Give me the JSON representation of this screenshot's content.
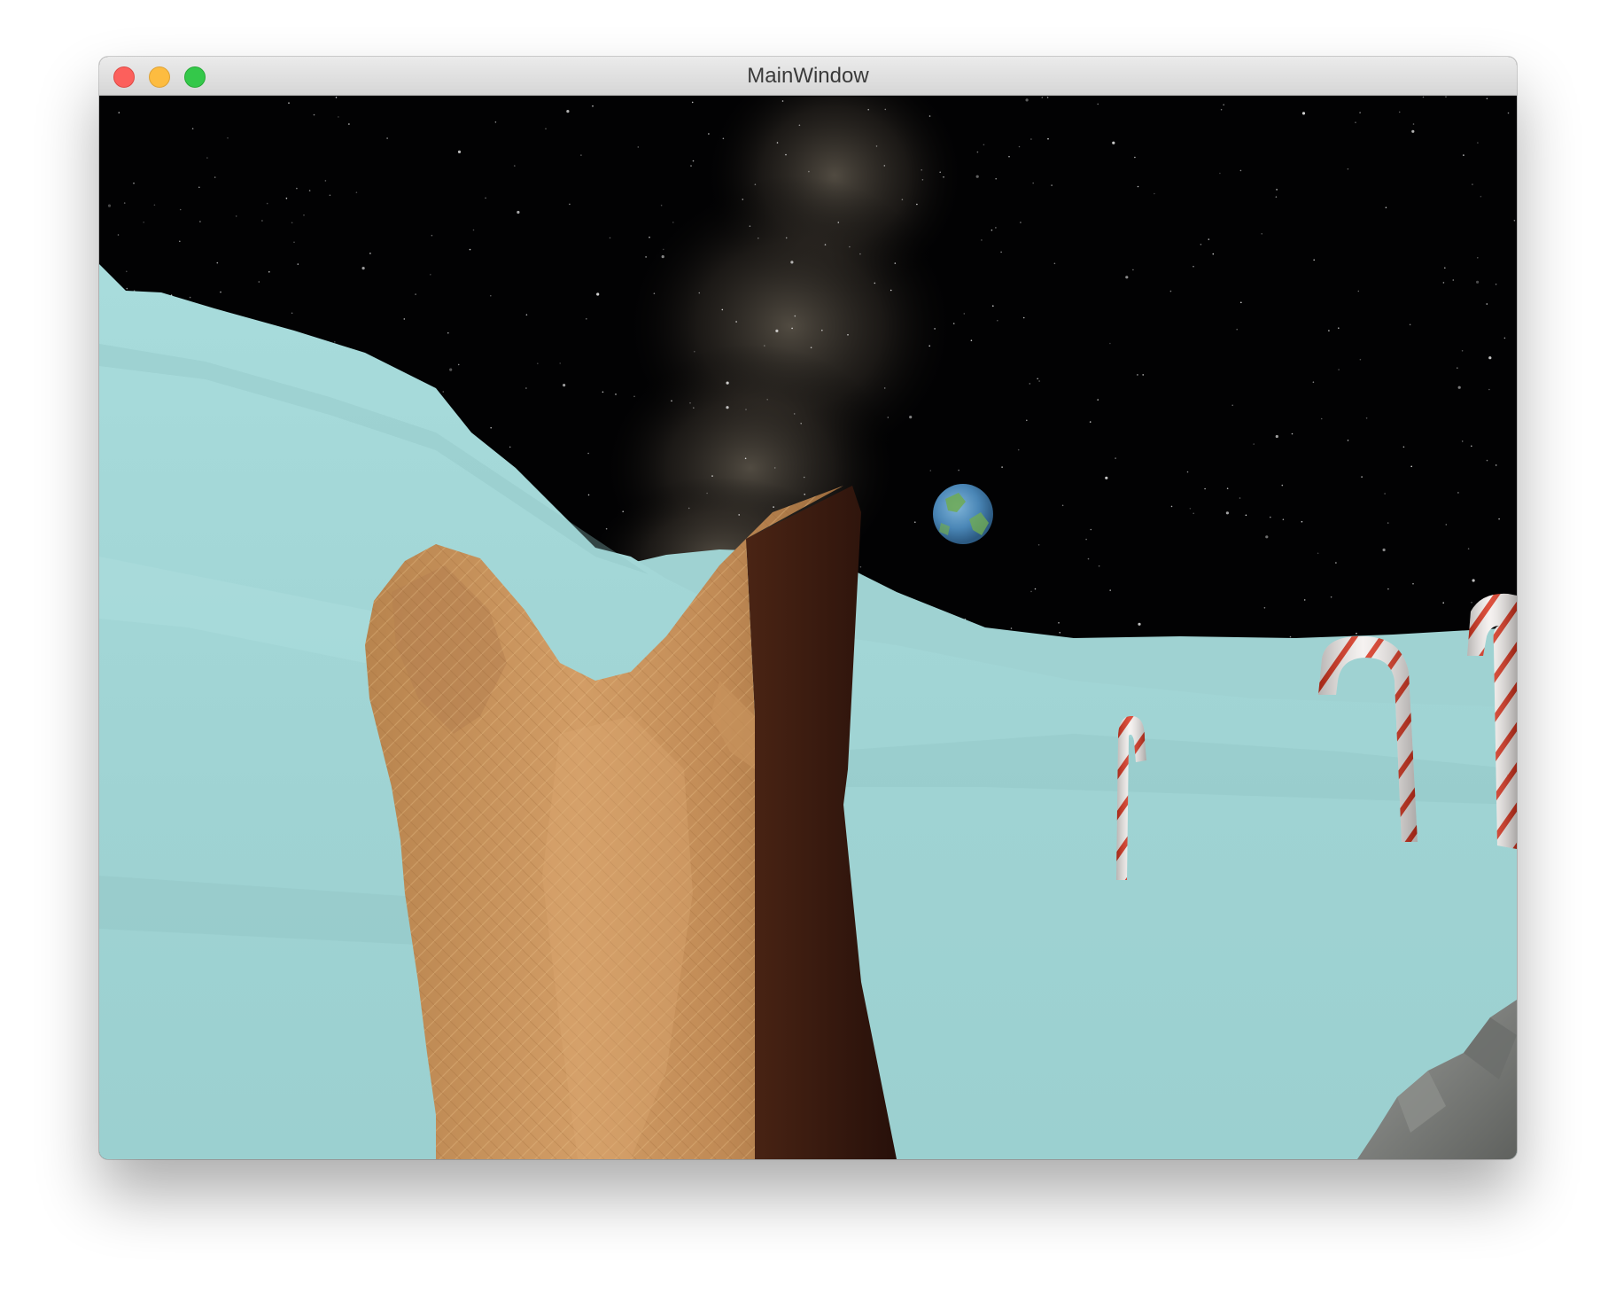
{
  "window": {
    "title": "MainWindow"
  },
  "scene": {
    "sky_color": "#020203",
    "milky_way_color": "#6b6356",
    "terrain_color": "#a3d8d8",
    "terrain_shade_color": "#8fc4c4",
    "fox_fur_color": "#c8935c",
    "fox_shadow_color": "#2e140c",
    "planet_ocean_color": "#4a86b6",
    "planet_land_color": "#6faa52",
    "candy_red_color": "#d8321c",
    "candy_white_color": "#f4f0ee",
    "rock_color": "#7e807d",
    "objects": [
      "milky-way",
      "earth-planet",
      "icy-terrain",
      "fox-head",
      "candy-cane",
      "candy-cane",
      "candy-cane",
      "rock"
    ]
  }
}
